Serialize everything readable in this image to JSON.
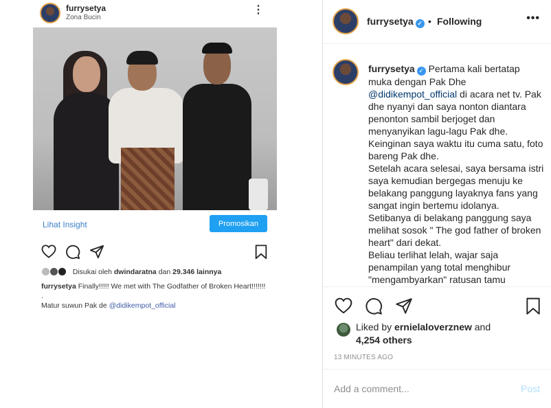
{
  "embedded_post": {
    "username": "furrysetya",
    "location": "Zona Bucin",
    "more_icon": "⋮",
    "insight_link": "Lihat Insight",
    "promote_button": "Promosikan",
    "likes_prefix": "Disukai oleh",
    "likes_user": "dwindaratna",
    "likes_suffix": "dan",
    "likes_count": "29.346 lainnya",
    "caption_user": "furrysetya",
    "caption_text": "Finally!!!!! We met with The Godfather of Broken Heart!!!!!!!",
    "caption_dot": ".",
    "caption_line3": "Matur suwun Pak de",
    "caption_mention": "@didikempot_official"
  },
  "post_panel": {
    "username": "furrysetya",
    "verified_icon": "✓",
    "separator": "•",
    "follow_status": "Following",
    "more_icon": "•••",
    "caption_user": "furrysetya",
    "caption_part1": "Pertama kali bertatap muka dengan Pak Dhe",
    "caption_mention": "@didikempot_official",
    "caption_part2": "di acara net tv. Pak dhe nyanyi dan saya nonton diantara penonton sambil berjoget dan menyanyikan lagu-lagu Pak dhe. Keinginan saya waktu itu cuma satu, foto bareng Pak dhe.",
    "caption_part3": "Setelah acara selesai, saya bersama istri saya kemudian bergegas menuju ke belakang panggung layaknya fans yang sangat ingin bertemu idolanya. Setibanya di belakang panggung saya melihat sosok \" The god father of broken heart\" dari dekat.",
    "caption_part4": "Beliau terlihat lelah, wajar saja penampilan yang total menghibur \"mengambyarkan\" ratusan tamu",
    "liked_by_prefix": "Liked by",
    "liked_by_user": "ernielaloverznew",
    "liked_by_suffix": "and",
    "liked_count": "4,254 others",
    "timestamp": "13 MINUTES AGO",
    "comment_placeholder": "Add a comment...",
    "post_button": "Post"
  },
  "colors": {
    "link_blue": "#3b80c9",
    "promote_blue": "#1fa0f2",
    "verified_blue": "#3897f0",
    "post_disabled": "#b2dffc",
    "story_ring": "#e4a34a"
  },
  "icons": [
    "heart-icon",
    "comment-icon",
    "share-icon",
    "bookmark-icon",
    "verified-badge-icon",
    "more-options-icon"
  ]
}
